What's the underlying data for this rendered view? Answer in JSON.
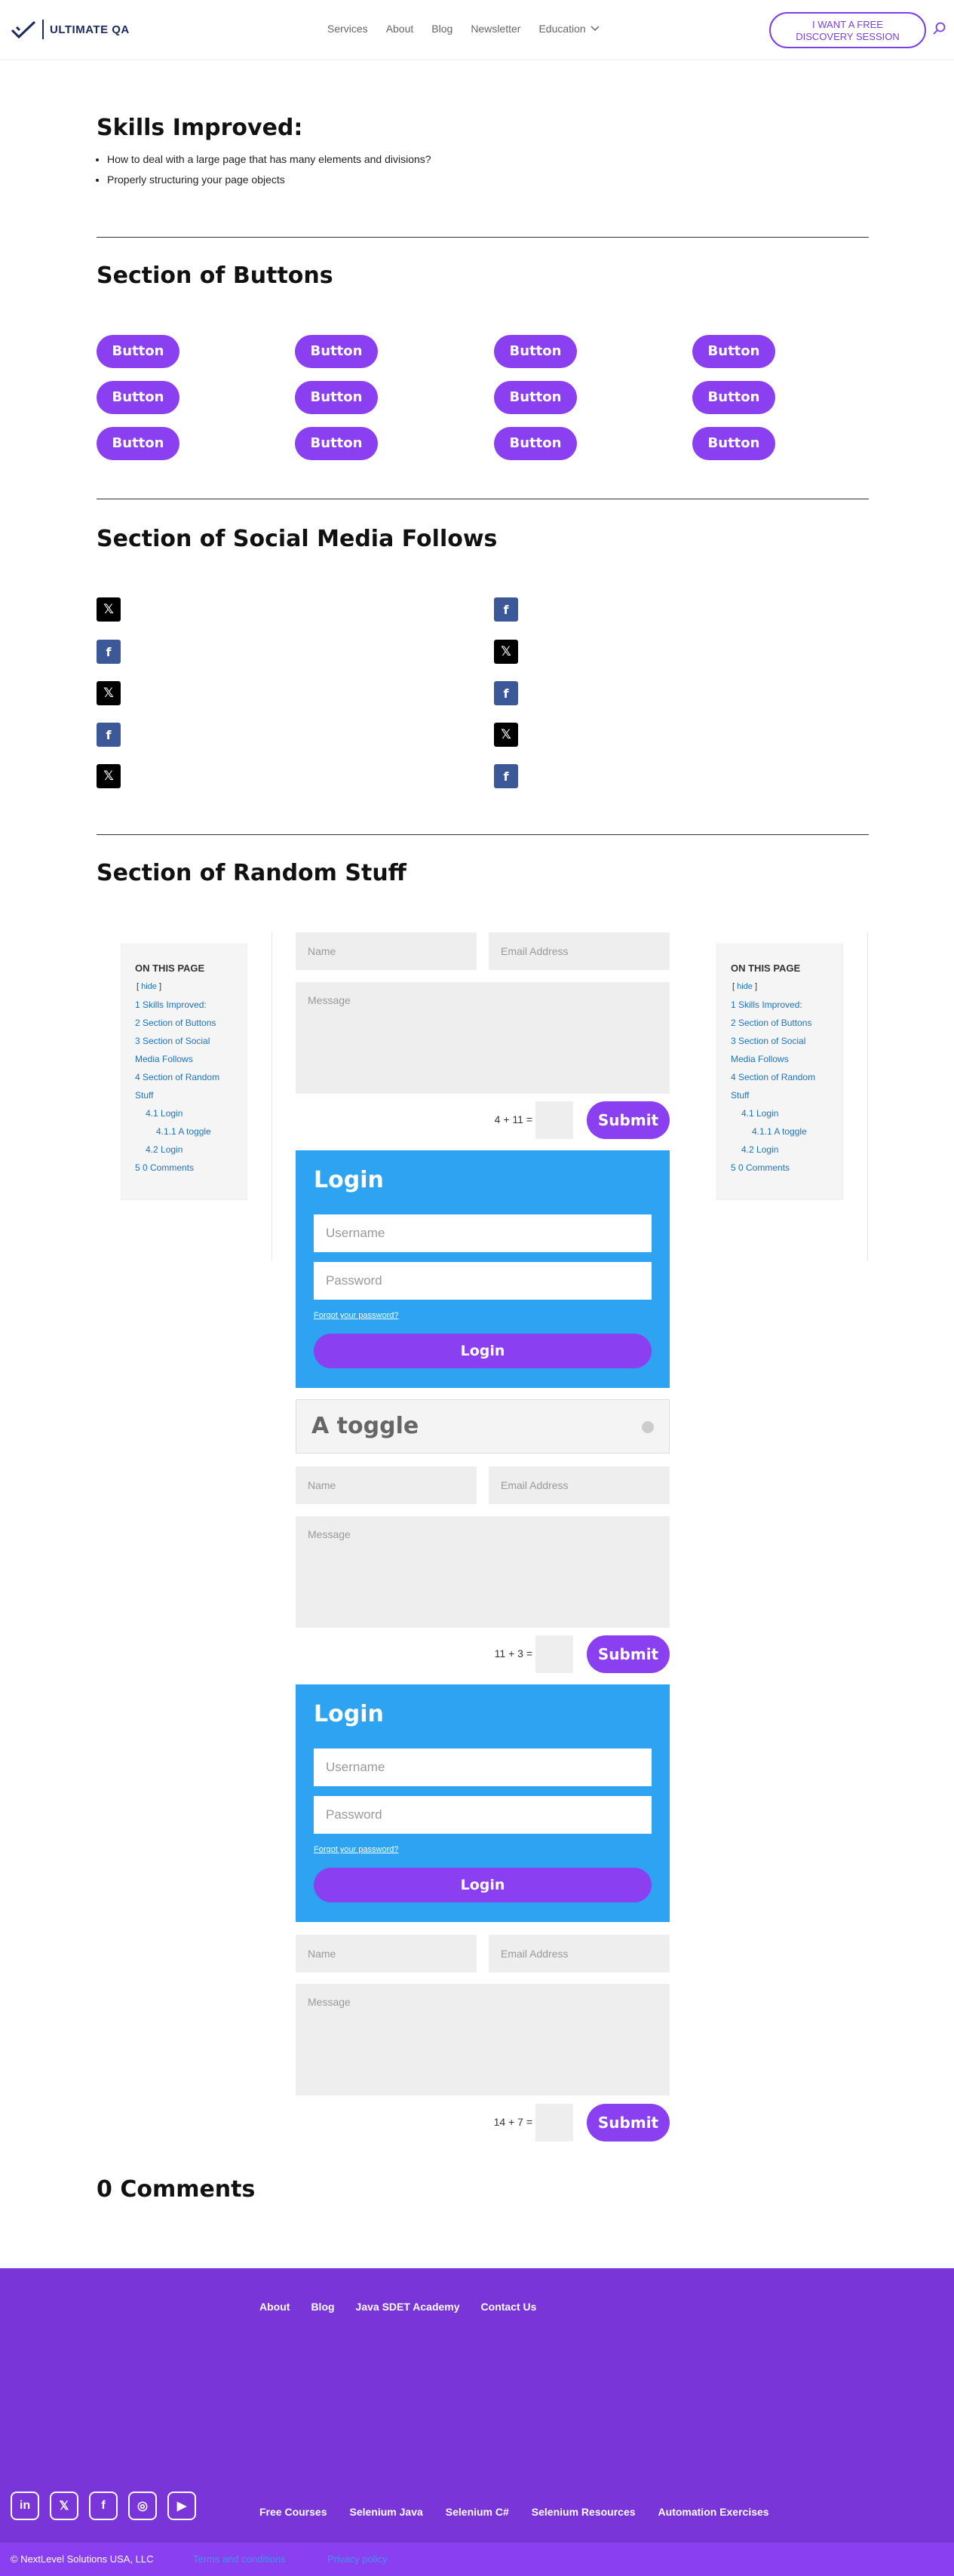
{
  "header": {
    "logo_text": "ULTIMATE QA",
    "nav": [
      "Services",
      "About",
      "Blog",
      "Newsletter",
      "Education"
    ],
    "cta_line1": "I WANT A FREE",
    "cta_line2": "DISCOVERY SESSION"
  },
  "skills": {
    "title": "Skills Improved:",
    "items": [
      "How to deal with a large page that has many elements and divisions?",
      "Properly structuring your page objects"
    ]
  },
  "buttons_section": {
    "title": "Section of Buttons",
    "button_label": "Button"
  },
  "social_section": {
    "title": "Section of Social Media Follows",
    "x_glyph": "𝕏",
    "fb_glyph": "f"
  },
  "random_section": {
    "title": "Section of Random Stuff"
  },
  "toc": {
    "title": "ON THIS PAGE",
    "hide_label": "hide",
    "items": [
      "1 Skills Improved:",
      "2 Section of Buttons",
      "3 Section of Social",
      "Media Follows",
      "4 Section of Random",
      "Stuff",
      "4.1 Login",
      "4.1.1 A toggle",
      "4.2 Login",
      "5 0 Comments"
    ]
  },
  "contact_form": {
    "name_placeholder": "Name",
    "email_placeholder": "Email Address",
    "message_placeholder": "Message",
    "submit_label": "Submit",
    "captchas": [
      "4 + 11 =",
      "11 + 3 =",
      "14 + 7 ="
    ]
  },
  "login": {
    "title": "Login",
    "username_placeholder": "Username",
    "password_placeholder": "Password",
    "forgot": "Forgot your password?",
    "button": "Login"
  },
  "toggle": {
    "title": "A toggle"
  },
  "comments": {
    "title": "0 Comments"
  },
  "footer": {
    "top_nav": [
      "About",
      "Blog",
      "Java SDET Academy",
      "Contact Us"
    ],
    "bottom_nav": [
      "Free Courses",
      "Selenium Java",
      "Selenium C#",
      "Selenium Resources",
      "Automation Exercises"
    ],
    "social_icons": [
      "in",
      "𝕏",
      "f",
      "◎",
      "▶"
    ],
    "copyright": "© NextLevel Solutions USA, LLC",
    "terms": "Terms and conditions",
    "privacy": "Privacy policy"
  }
}
